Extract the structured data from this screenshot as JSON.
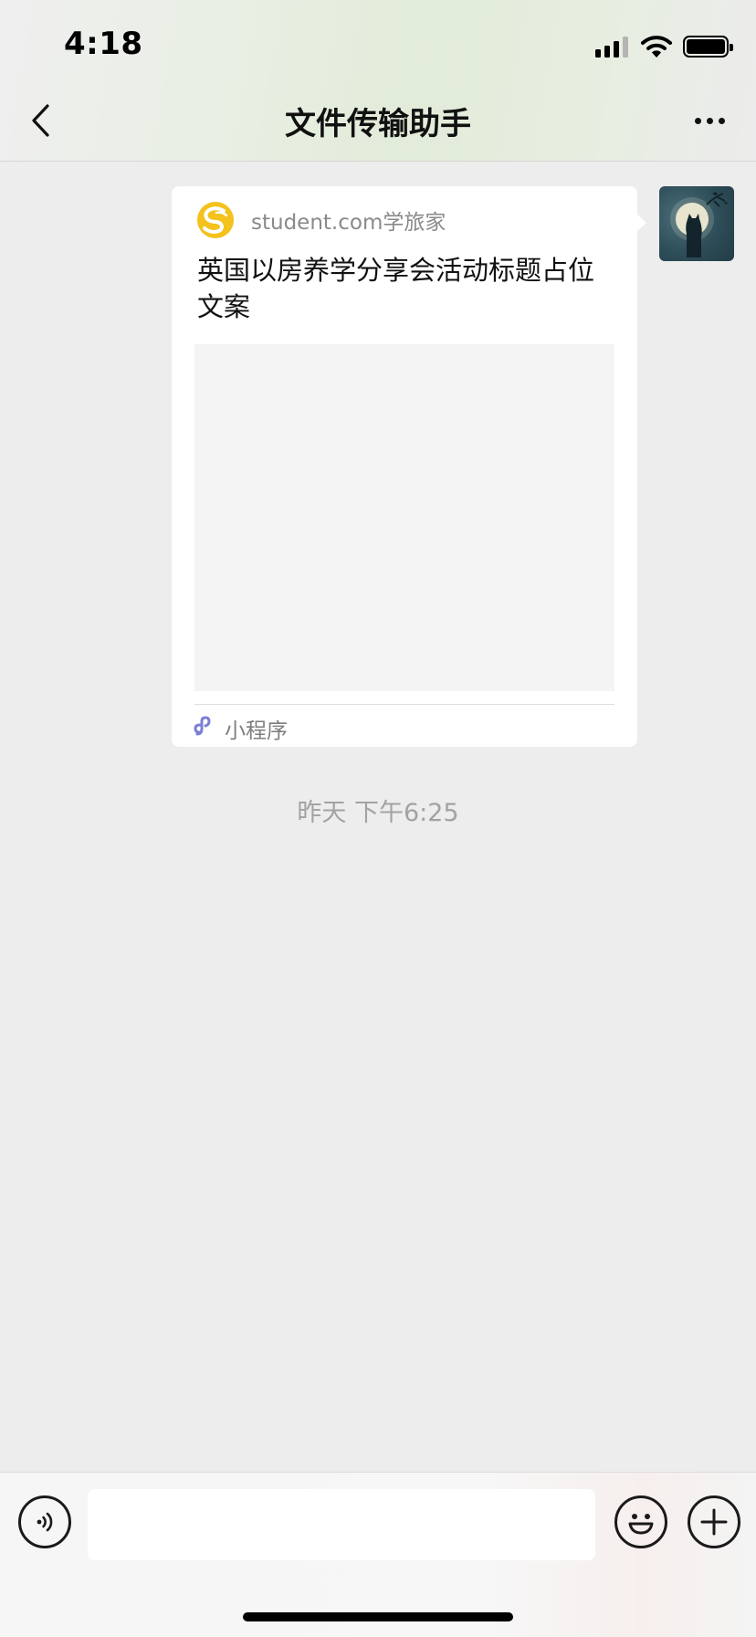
{
  "status_bar": {
    "time": "4:18",
    "icons": [
      "cellular-signal-icon",
      "wifi-icon",
      "battery-icon"
    ],
    "signal_bars_active": 3,
    "signal_bars_total": 4,
    "battery_level": 1.0
  },
  "nav": {
    "title": "文件传输助手",
    "back_icon": "chevron-left-icon",
    "more_icon": "ellipsis-icon"
  },
  "message": {
    "sender_avatar": "cat-moon-avatar",
    "mini_program": {
      "logo_icon": "student-com-logo-icon",
      "source": "student.com学旅家",
      "title": "英国以房养学分享会活动标题占位文案",
      "type_icon": "link-icon",
      "type_label": "小程序"
    },
    "timestamp": "昨天 下午6:25"
  },
  "input_bar": {
    "voice_icon": "voice-icon",
    "input_value": "",
    "emoji_icon": "smiley-icon",
    "plus_icon": "plus-icon"
  },
  "colors": {
    "chat_background": "#ededed",
    "logo_yellow": "#f0b51e",
    "mini_program_icon": "#7b7fd6"
  }
}
